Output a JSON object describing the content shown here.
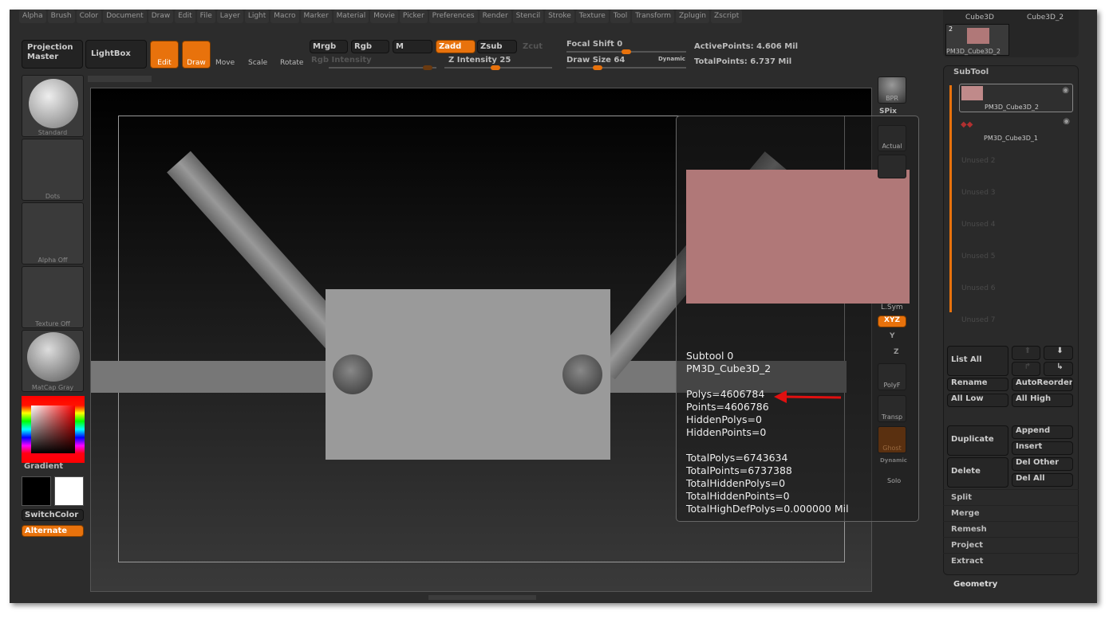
{
  "menu": [
    "Alpha",
    "Brush",
    "Color",
    "Document",
    "Draw",
    "Edit",
    "File",
    "Layer",
    "Light",
    "Macro",
    "Marker",
    "Material",
    "Movie",
    "Picker",
    "Preferences",
    "Render",
    "Stencil",
    "Stroke",
    "Texture",
    "Tool",
    "Transform",
    "Zplugin",
    "Zscript"
  ],
  "toolbar": {
    "projection_master": "Projection Master",
    "lightbox": "LightBox",
    "edit": "Edit",
    "draw": "Draw",
    "move": "Move",
    "scale": "Scale",
    "rotate": "Rotate",
    "mrgb": "Mrgb",
    "rgb": "Rgb",
    "m": "M",
    "zadd": "Zadd",
    "zsub": "Zsub",
    "zcut": "Zcut",
    "rgb_intensity": "Rgb Intensity",
    "z_intensity": "Z Intensity 25",
    "focal_shift": "Focal Shift 0",
    "draw_size": "Draw Size 64",
    "dynamic": "Dynamic",
    "active_points": "ActivePoints: 4.606 Mil",
    "total_points": "TotalPoints: 6.737 Mil",
    "z_intensity_value": 25,
    "focal_shift_value": 0,
    "draw_size_value": 64
  },
  "shelf": {
    "brush": "Standard",
    "stroke": "Dots",
    "alpha": "Alpha Off",
    "texture": "Texture Off",
    "material": "MatCap Gray",
    "gradient": "Gradient",
    "switch_color": "SwitchColor",
    "alternate": "Alternate"
  },
  "right_shelf": {
    "bpr": "BPR",
    "spix": "SPix",
    "actual": "Actual",
    "lsym": "L.Sym",
    "xyz": "XYZ",
    "y": "Y",
    "z": "Z",
    "polyf": "PolyF",
    "transp": "Transp",
    "ghost": "Ghost",
    "dynamic": "Dynamic",
    "solo": "Solo"
  },
  "tool_thumbs": {
    "a": "Cube3D",
    "b": "Cube3D_2",
    "c": "PM3D_Cube3D_2",
    "c_count": "2"
  },
  "subtool": {
    "title": "SubTool",
    "items": [
      {
        "name": "PM3D_Cube3D_2",
        "selected": true
      },
      {
        "name": "PM3D_Cube3D_1"
      }
    ],
    "unused": [
      "Unused 2",
      "Unused 3",
      "Unused 4",
      "Unused 5",
      "Unused 6",
      "Unused 7"
    ],
    "buttons": {
      "list_all": "List All",
      "rename": "Rename",
      "autoreorder": "AutoReorder",
      "all_low": "All Low",
      "all_high": "All High",
      "duplicate": "Duplicate",
      "append": "Append",
      "insert": "Insert",
      "delete": "Delete",
      "del_other": "Del Other",
      "del_all": "Del All"
    },
    "rows": [
      "Split",
      "Merge",
      "Remesh",
      "Project",
      "Extract"
    ]
  },
  "geometry": "Geometry",
  "info": {
    "lines": [
      "Subtool 0",
      "PM3D_Cube3D_2",
      "",
      "Polys=4606784",
      "Points=4606786",
      "HiddenPolys=0",
      "HiddenPoints=0",
      "",
      "TotalPolys=6743634",
      "TotalPoints=6737388",
      "TotalHiddenPolys=0",
      "TotalHiddenPoints=0",
      "TotalHighDefPolys=0.000000 Mil"
    ]
  },
  "colors": {
    "accent": "#e8720c",
    "subtool_color": "#b07878",
    "arrow": "#e01010"
  }
}
